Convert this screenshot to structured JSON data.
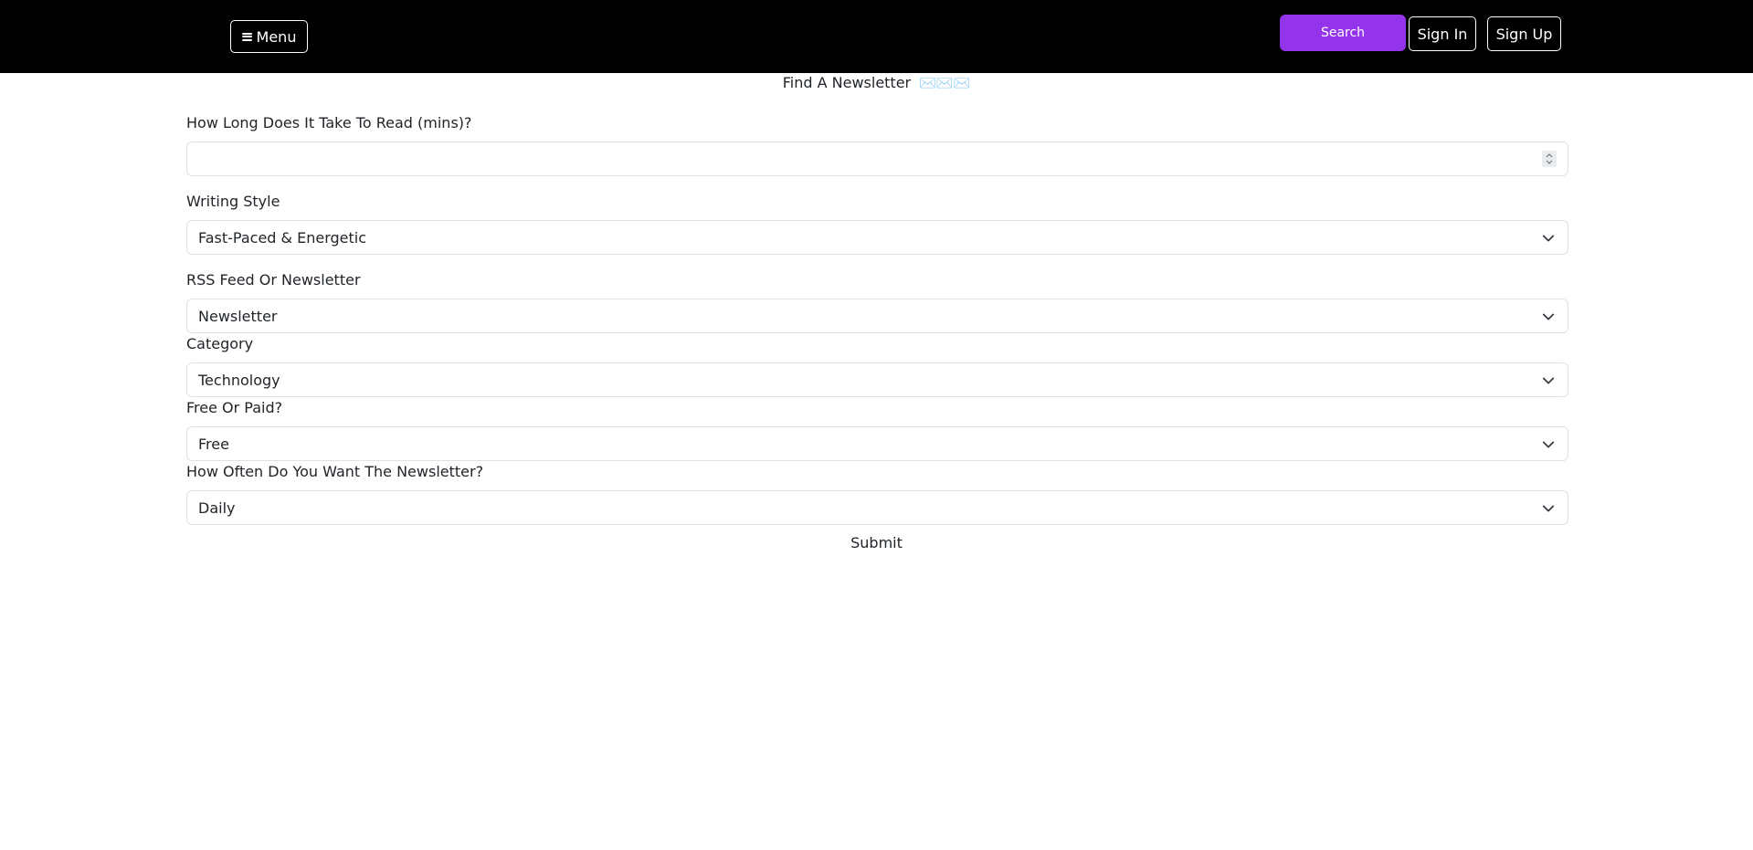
{
  "nav": {
    "menu_label": "Menu",
    "menu_icon": "hamburger-icon",
    "search_label": "Search",
    "signin_label": "Sign In",
    "signup_label": "Sign Up",
    "search_color": "#9333ea"
  },
  "page": {
    "title": "Find A Newsletter",
    "title_icons": "✉️✉️✉️"
  },
  "form": {
    "read_time": {
      "label": "How Long Does It Take To Read (mins)?",
      "value": ""
    },
    "writing_style": {
      "label": "Writing Style",
      "value": "Fast-Paced & Energetic"
    },
    "feed_type": {
      "label": "RSS Feed Or Newsletter",
      "value": "Newsletter"
    },
    "category": {
      "label": "Category",
      "value": "Technology"
    },
    "pricing": {
      "label": "Free Or Paid?",
      "value": "Free"
    },
    "frequency": {
      "label": "How Often Do You Want The Newsletter?",
      "value": "Daily"
    },
    "submit_label": "Submit"
  }
}
